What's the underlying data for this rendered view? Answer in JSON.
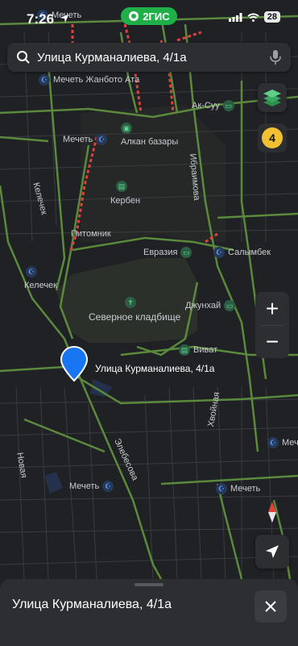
{
  "status": {
    "time": "7:26",
    "app_name": "2ГИС",
    "battery": "28"
  },
  "search": {
    "query": "Улица Курманалиева, 4/1а"
  },
  "traffic": {
    "level": "4"
  },
  "zoom": {
    "in_label": "+",
    "out_label": "−"
  },
  "map": {
    "pin_label": "Улица Курманалиева, 4/1а",
    "pois": [
      {
        "label": "Мечеть",
        "kind": "mosque"
      },
      {
        "label": "Мечеть Жанбото Ата",
        "kind": "mosque"
      },
      {
        "label": "Мечеть",
        "kind": "mosque"
      },
      {
        "label": "Алкан базары",
        "kind": "market"
      },
      {
        "label": "Ак-Суу",
        "kind": "transport"
      },
      {
        "label": "Кербен",
        "kind": "shop"
      },
      {
        "label": "Евразия",
        "kind": "transport"
      },
      {
        "label": "Салымбек",
        "kind": "mosque"
      },
      {
        "label": "Келечек",
        "kind": "mosque"
      },
      {
        "label": "Северное кладбище",
        "kind": "cemetery"
      },
      {
        "label": "Джунхай",
        "kind": "transport"
      },
      {
        "label": "Виват",
        "kind": "shop"
      },
      {
        "label": "Мечеть",
        "kind": "mosque"
      },
      {
        "label": "Мечеть",
        "kind": "mosque"
      },
      {
        "label": "Мечеть",
        "kind": "mosque"
      }
    ],
    "streets": [
      "Питомник",
      "Ибраимова",
      "Элебесова",
      "Хвойная",
      "Новая",
      "Келечек"
    ]
  },
  "sheet": {
    "title": "Улица Курманалиева, 4/1а"
  },
  "colors": {
    "road_green": "#5b8a3c",
    "traffic_red": "#e0413b",
    "accent_blue": "#1976f2",
    "app_green": "#1fb04a",
    "traffic_badge": "#f2c032"
  },
  "icons": [
    "location-arrow-icon",
    "search-icon",
    "mic-icon",
    "layers-icon",
    "compass-icon",
    "my-location-icon",
    "close-icon"
  ]
}
